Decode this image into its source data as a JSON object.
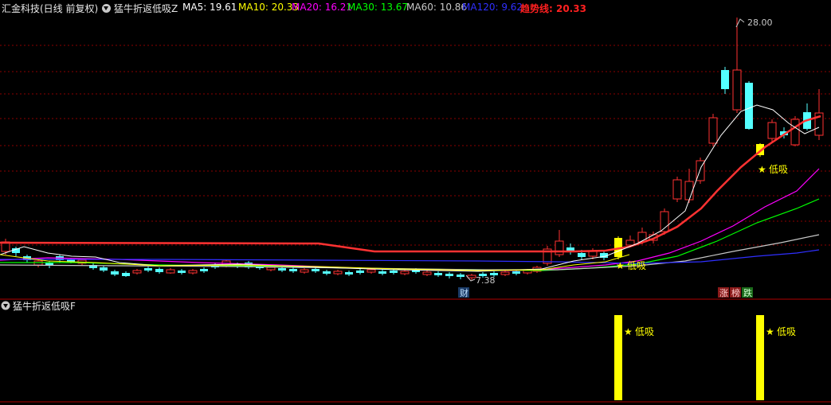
{
  "header": {
    "stock_title": "汇金科技(日线 前复权)",
    "indicator_name": "猛牛折返低吸Z",
    "ma": [
      {
        "label": "MA5: 19.61",
        "color": "#ffffff"
      },
      {
        "label": "MA10: 20.33",
        "color": "#ffff00"
      },
      {
        "label": "MA20: 16.21",
        "color": "#ff00ff"
      },
      {
        "label": "MA30: 13.67",
        "color": "#00ff00"
      },
      {
        "label": "MA60: 10.86",
        "color": "#c8c8c8"
      },
      {
        "label": "MA120: 9.62",
        "color": "#0000ff"
      }
    ],
    "trend_label": "趋势线: 20.33",
    "trend_color": "#ff2020"
  },
  "price_chart": {
    "high_label": "28.00",
    "low_label": "7.38",
    "signal_label": "低吸",
    "event_label_fin": "财",
    "event_labels_right": [
      "涨",
      "榜",
      "跌"
    ]
  },
  "sub_panel": {
    "title": "猛牛折返低吸F",
    "signal_label": "低吸"
  },
  "colors": {
    "up": "#ff3232",
    "down": "#54ffff",
    "signal": "#ffff00",
    "grid": "#8b0000"
  }
}
